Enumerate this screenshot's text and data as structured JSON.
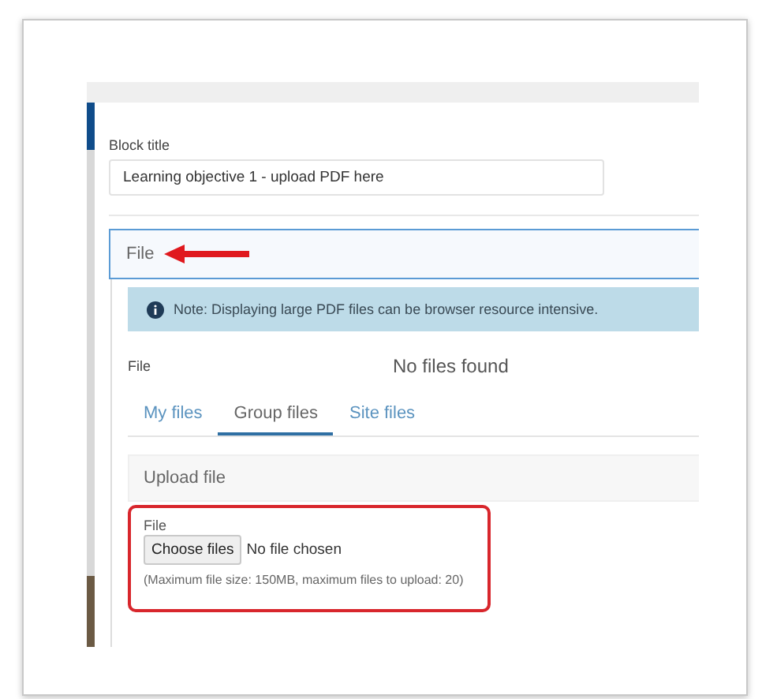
{
  "block_title": {
    "label": "Block title",
    "value": "Learning objective 1 - upload PDF here"
  },
  "file_section": {
    "title": "File",
    "annotated": true,
    "notice": "Note: Displaying large PDF files can be browser resource intensive.",
    "file_label": "File",
    "empty_message": "No files found",
    "tabs": [
      {
        "label": "My files",
        "selected": false
      },
      {
        "label": "Group files",
        "selected": true
      },
      {
        "label": "Site files",
        "selected": false
      }
    ],
    "upload_panel": {
      "title": "Upload file"
    },
    "upload_field": {
      "label": "File",
      "button": "Choose files",
      "status": "No file chosen",
      "hint": "(Maximum file size: 150MB, maximum files to upload: 20)",
      "highlighted": true
    }
  }
}
